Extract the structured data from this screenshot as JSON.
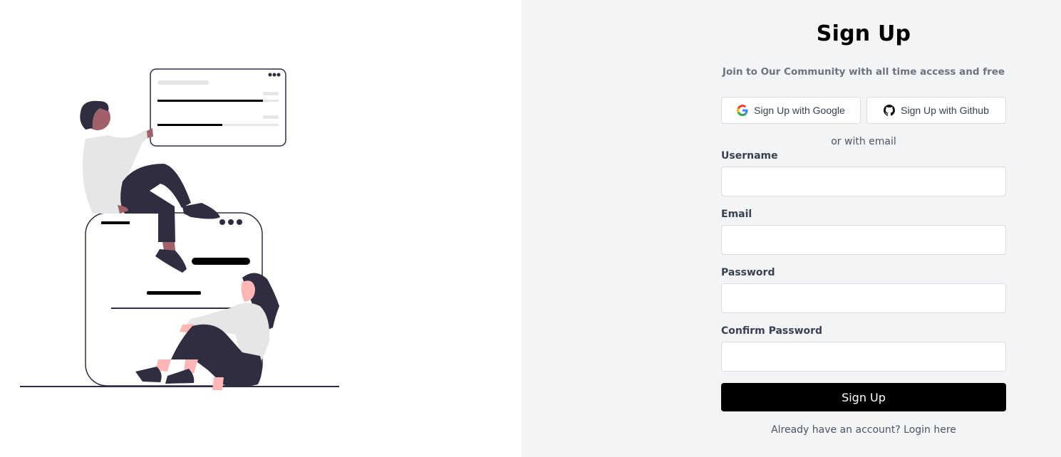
{
  "form": {
    "title": "Sign Up",
    "subtitle": "Join to Our Community with all time access and free",
    "oauth": {
      "google_label": "Sign Up with Google",
      "github_label": "Sign Up with Github"
    },
    "divider_text": "or with email",
    "fields": {
      "username": {
        "label": "Username",
        "value": "",
        "placeholder": ""
      },
      "email": {
        "label": "Email",
        "value": "",
        "placeholder": ""
      },
      "password": {
        "label": "Password",
        "value": "",
        "placeholder": ""
      },
      "confirm_password": {
        "label": "Confirm Password",
        "value": "",
        "placeholder": ""
      }
    },
    "submit_label": "Sign Up",
    "footer": {
      "prompt": "Already have an account?",
      "link_label": "Login here"
    }
  },
  "icons": {
    "google": "google-icon",
    "github": "github-icon"
  },
  "colors": {
    "form_background": "#f3f4f6",
    "primary_button": "#000000",
    "illustration_dark": "#2f2e41",
    "illustration_skin_1": "#a0616a",
    "illustration_skin_2": "#ffb6b6",
    "illustration_shirt": "#e6e6e6"
  }
}
